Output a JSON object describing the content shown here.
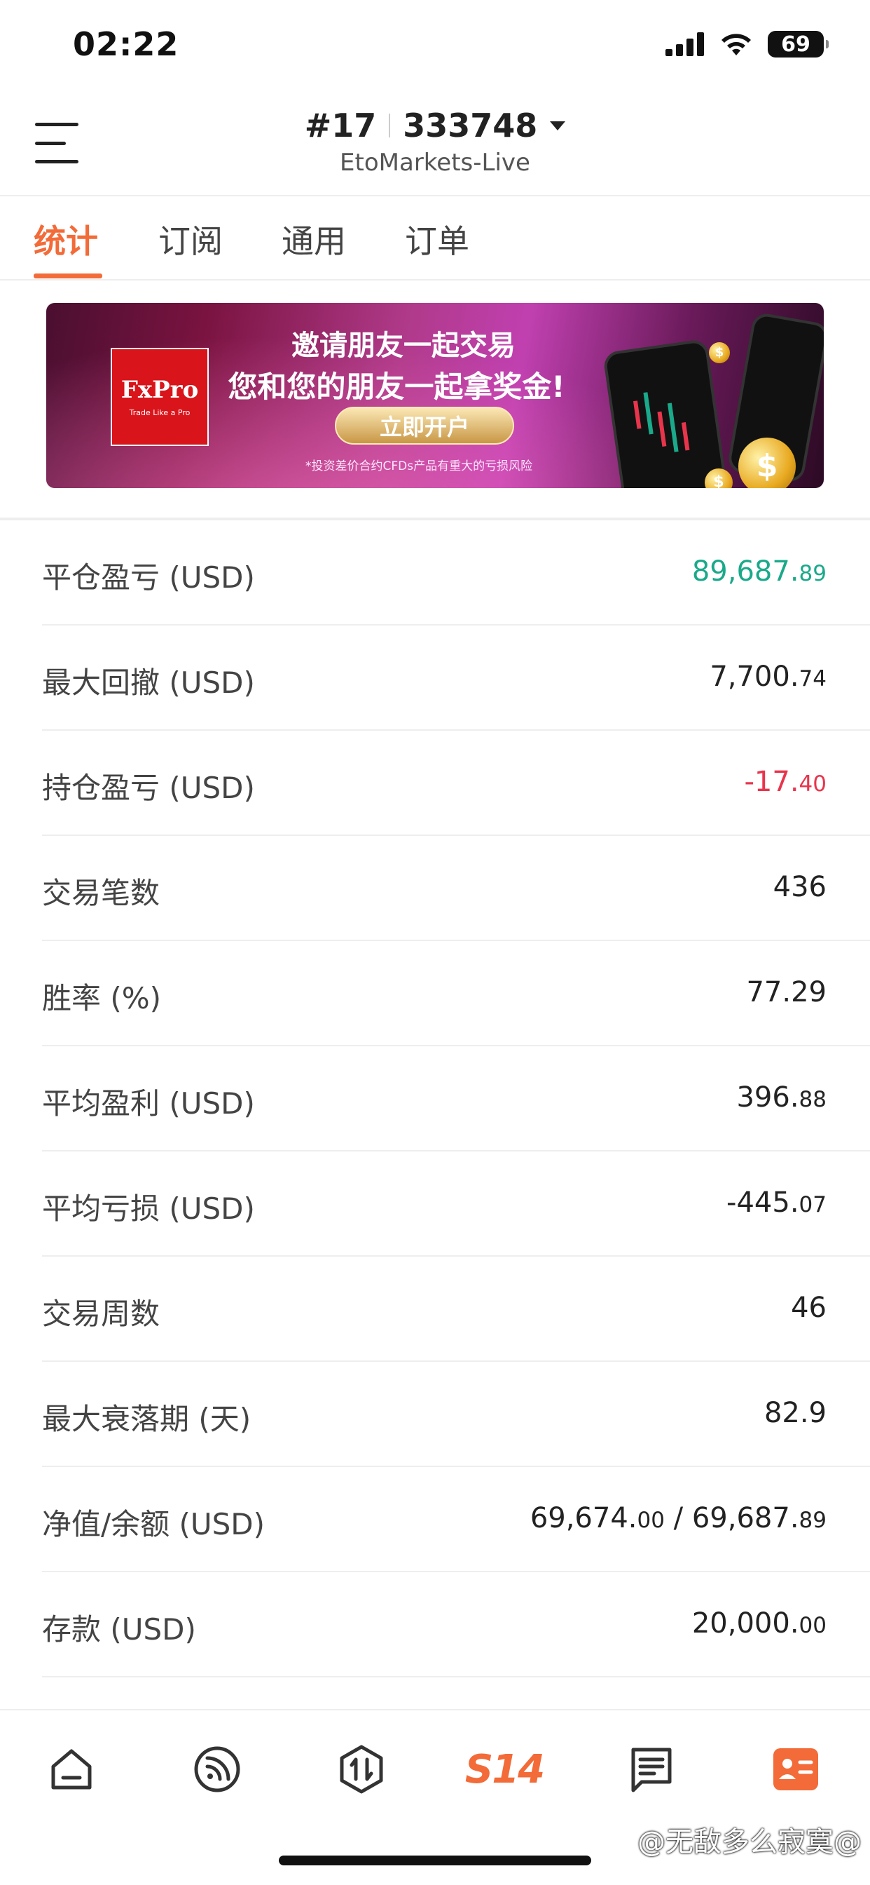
{
  "status_bar": {
    "time": "02:22",
    "battery": "69"
  },
  "header": {
    "account_prefix": "#17",
    "account_number": "333748",
    "server": "EtoMarkets-Live"
  },
  "tabs": [
    {
      "label": "统计",
      "active": true
    },
    {
      "label": "订阅",
      "active": false
    },
    {
      "label": "通用",
      "active": false
    },
    {
      "label": "订单",
      "active": false
    }
  ],
  "banner": {
    "logo_name": "FxPro",
    "logo_tagline": "Trade Like a Pro",
    "title_line1": "邀请朋友一起交易",
    "title_line2": "您和您的朋友一起拿奖金!",
    "cta": "立即开户",
    "disclaimer": "*投资差价合约CFDs产品有重大的亏损风险"
  },
  "stats": [
    {
      "label": "平仓盈亏 (USD)",
      "int": "89,687.",
      "dec": "89",
      "color": "green"
    },
    {
      "label": "最大回撤 (USD)",
      "int": "7,700.",
      "dec": "74",
      "color": "default"
    },
    {
      "label": "持仓盈亏 (USD)",
      "int": "-17.",
      "dec": "40",
      "color": "red"
    },
    {
      "label": "交易笔数",
      "int": "436",
      "dec": "",
      "color": "default"
    },
    {
      "label": "胜率 (%)",
      "int": "77.29",
      "dec": "",
      "color": "default"
    },
    {
      "label": "平均盈利 (USD)",
      "int": "396.",
      "dec": "88",
      "color": "default"
    },
    {
      "label": "平均亏损 (USD)",
      "int": "-445.",
      "dec": "07",
      "color": "default"
    },
    {
      "label": "交易周数",
      "int": "46",
      "dec": "",
      "color": "default"
    },
    {
      "label": "最大衰落期 (天)",
      "int": "82.9",
      "dec": "",
      "color": "default"
    },
    {
      "label": "净值/余额 (USD)",
      "int": "69,674.",
      "dec": "00",
      "int2": " / 69,687.",
      "dec2": "89",
      "color": "default"
    },
    {
      "label": "存款 (USD)",
      "int": "20,000.",
      "dec": "00",
      "color": "default"
    }
  ],
  "bottom_nav": {
    "items": [
      "home-icon",
      "feed-icon",
      "trade-icon",
      "s14-logo",
      "message-icon",
      "profile-card-icon"
    ],
    "s14_label": "S14",
    "active": "profile-card-icon"
  },
  "watermark": "@无敌多么寂寞@",
  "colors": {
    "accent": "#f26b38",
    "profit": "#1aa98a",
    "loss": "#e8354c"
  }
}
